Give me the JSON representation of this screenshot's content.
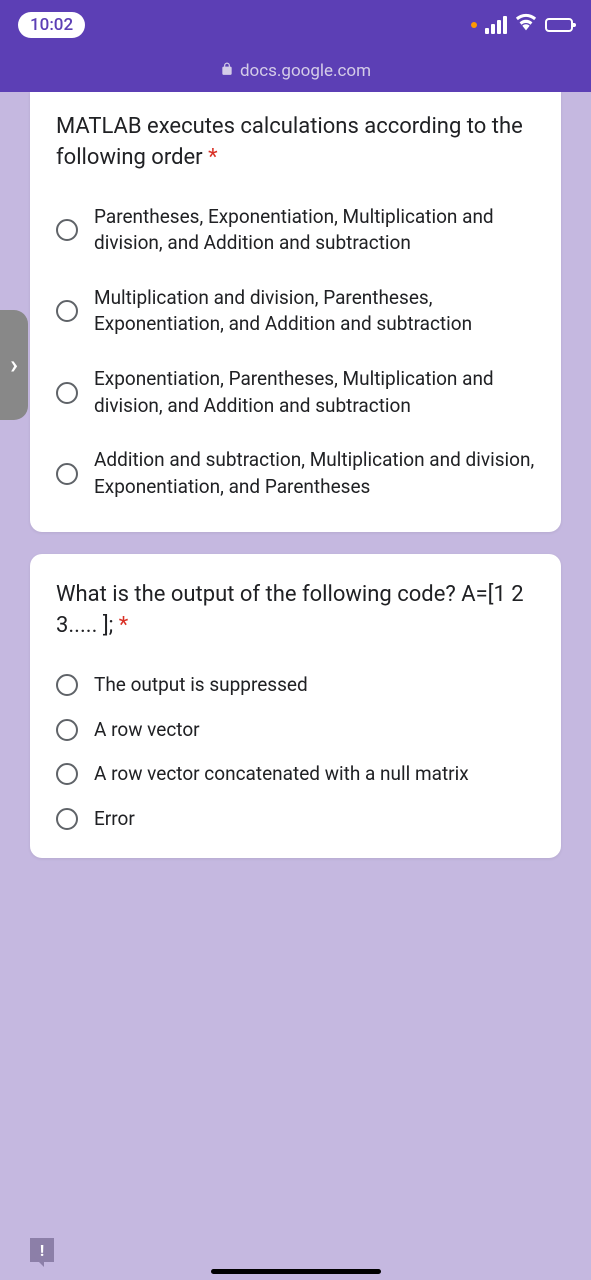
{
  "status": {
    "time": "10:02"
  },
  "url": "docs.google.com",
  "q1": {
    "text": "MATLAB executes calculations according to the following order",
    "required": "*",
    "options": [
      "Parentheses, Exponentiation, Multiplication and division, and Addition and subtraction",
      "Multiplication and division, Parentheses, Exponentiation, and Addition and subtraction",
      "Exponentiation, Parentheses, Multiplication and division, and Addition and subtraction",
      "Addition and subtraction, Multiplication and division, Exponentiation, and Parentheses"
    ]
  },
  "q2": {
    "text": "What is the output of the following code? A=[1 2 3..... ];",
    "required": "*",
    "options": [
      "The output is suppressed",
      "A row vector",
      "A row vector concatenated with a null matrix",
      "Error"
    ]
  },
  "side": "›",
  "feedback": "!"
}
